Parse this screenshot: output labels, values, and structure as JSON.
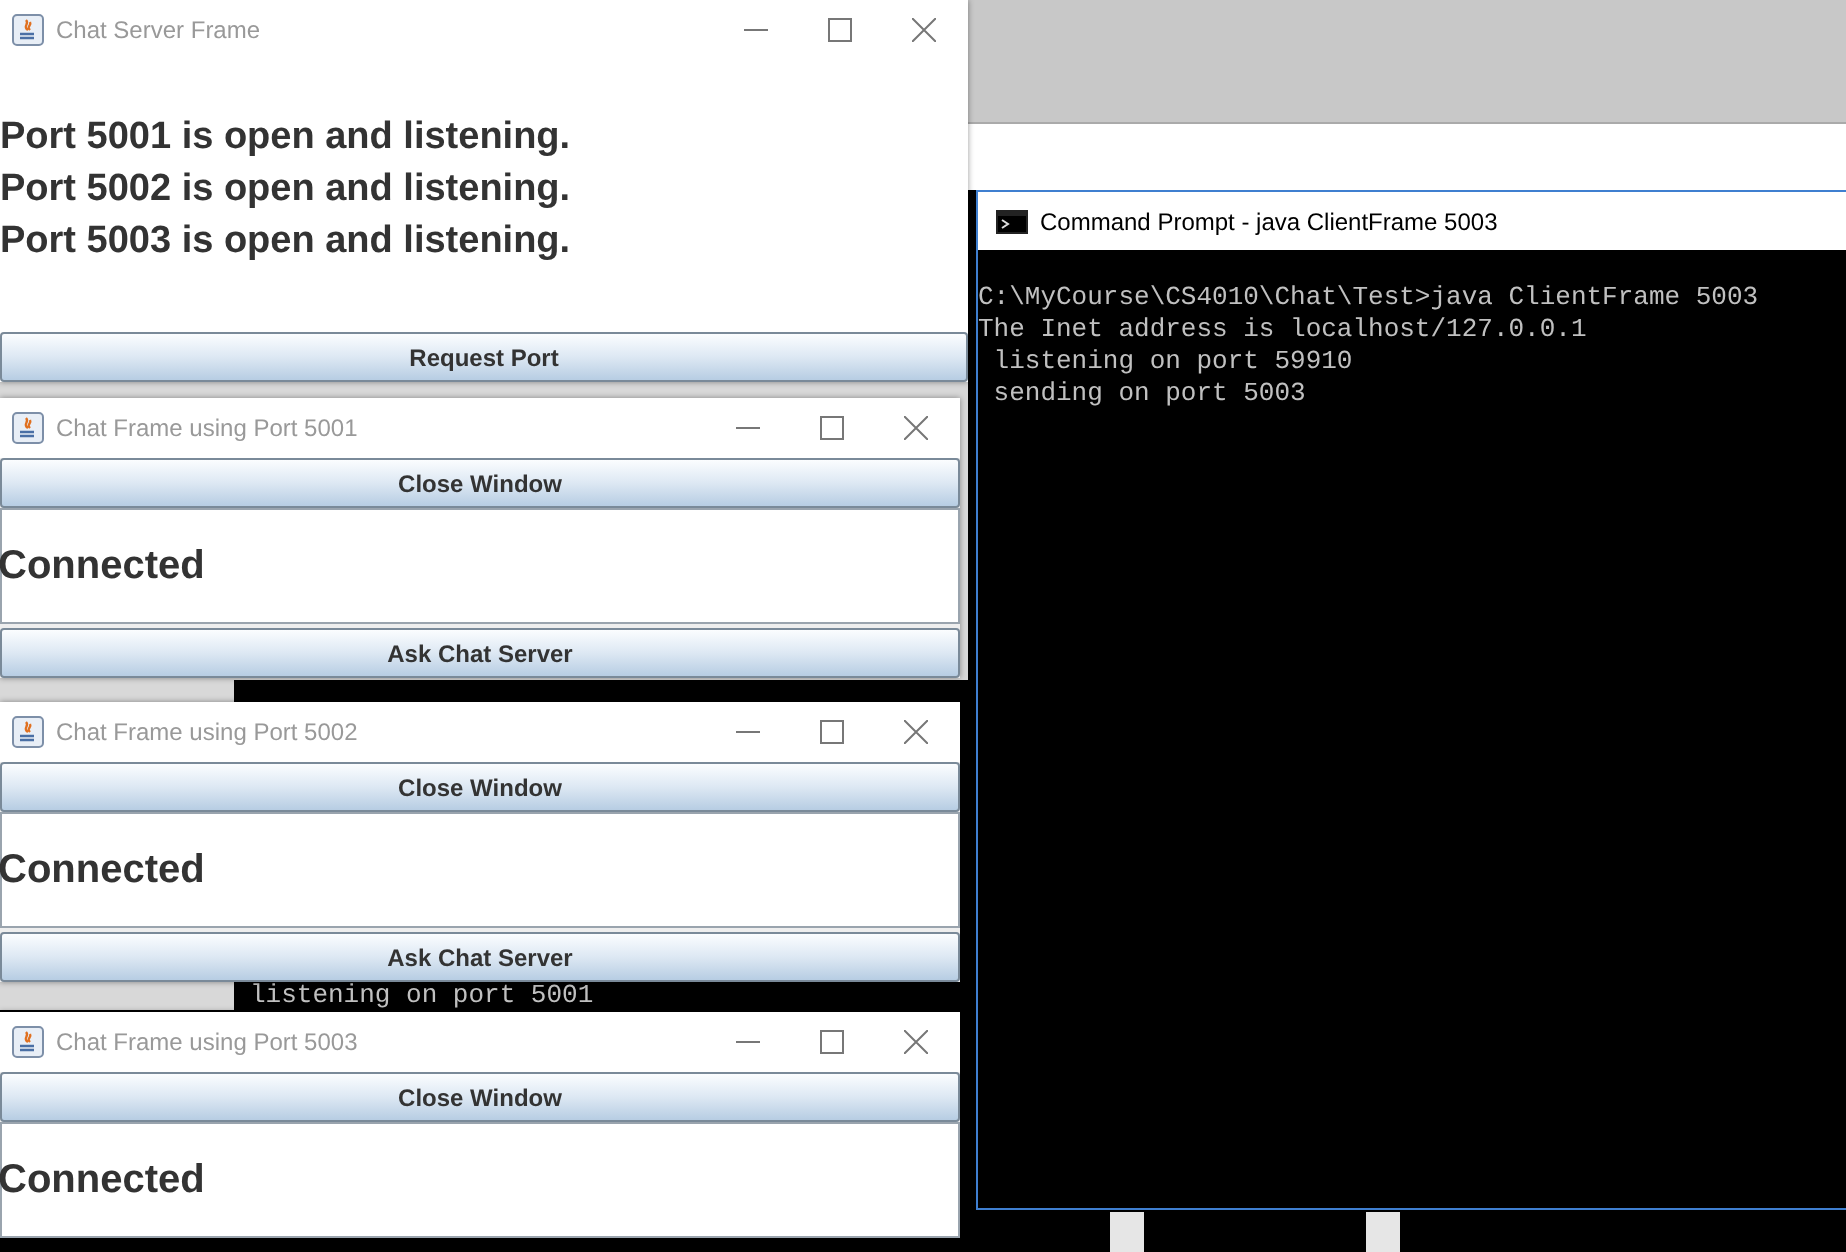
{
  "server_frame": {
    "title": "Chat Server Frame",
    "messages": [
      "Port 5001 is open and listening.",
      "Port 5002 is open and listening.",
      "Port 5003 is open and listening."
    ],
    "button": "Request Port"
  },
  "chat_frames": [
    {
      "title": "Chat Frame using Port 5001",
      "close_button": "Close Window",
      "status": "Connected",
      "ask_button": "Ask Chat Server"
    },
    {
      "title": "Chat Frame using Port 5002",
      "close_button": "Close Window",
      "status": "Connected",
      "ask_button": "Ask Chat Server"
    },
    {
      "title": "Chat Frame using Port 5003",
      "close_button": "Close Window",
      "status": "Connected"
    }
  ],
  "background_console": {
    "lines": [
      "listening on port 5001"
    ]
  },
  "command_prompt": {
    "title": "Command Prompt - java  ClientFrame 5003",
    "lines": [
      "C:\\MyCourse\\CS4010\\Chat\\Test>java ClientFrame 5003",
      "The Inet address is localhost/127.0.0.1",
      " listening on port 59910",
      " sending on port 5003"
    ]
  }
}
